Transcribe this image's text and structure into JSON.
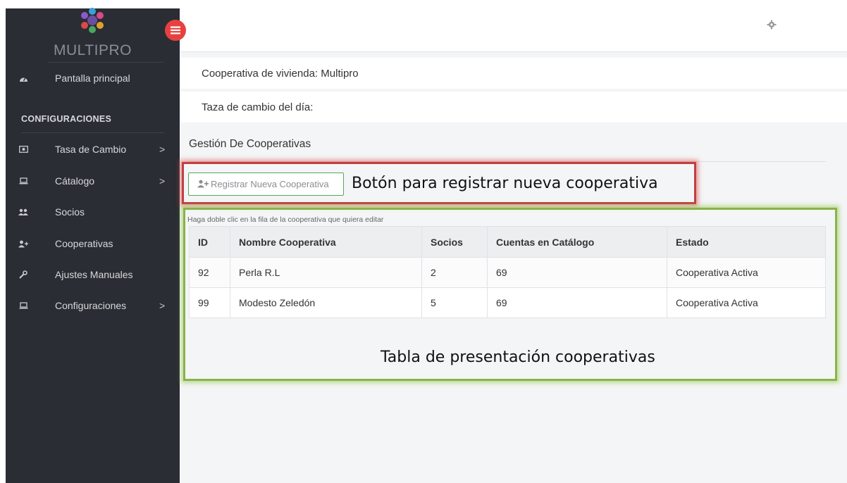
{
  "brand": {
    "name": "MULTIPRO"
  },
  "sidebar": {
    "items": [
      {
        "label": "Pantalla principal",
        "icon": "dashboard-icon"
      },
      {
        "label": "Tasa de Cambio",
        "icon": "money-icon",
        "has_submenu": true
      },
      {
        "label": "Cátalogo",
        "icon": "laptop-icon",
        "has_submenu": true
      },
      {
        "label": "Socios",
        "icon": "users-icon"
      },
      {
        "label": "Cooperativas",
        "icon": "user-plus-icon"
      },
      {
        "label": "Ajustes Manuales",
        "icon": "wrench-icon"
      },
      {
        "label": "Configuraciones",
        "icon": "laptop-icon",
        "has_submenu": true
      }
    ],
    "section_header": "CONFIGURACIONES",
    "chevron": ">"
  },
  "info": {
    "cooperative": "Cooperativa de vivienda: Multipro",
    "exchange_rate": "Taza de cambio del día:"
  },
  "page": {
    "title": "Gestión De Cooperativas",
    "register_button": "Registrar Nueva Cooperativa",
    "hint": "Haga doble clic en la fila de la cooperativa que quiera editar"
  },
  "table": {
    "headers": [
      "ID",
      "Nombre Cooperativa",
      "Socios",
      "Cuentas en Catálogo",
      "Estado"
    ],
    "rows": [
      [
        "92",
        "Perla R.L",
        "2",
        "69",
        "Cooperativa Activa"
      ],
      [
        "99",
        "Modesto Zeledón",
        "5",
        "69",
        "Cooperativa Activa"
      ]
    ]
  },
  "annotations": {
    "button_note": "Botón para registrar nueva cooperativa",
    "table_note": "Tabla de presentación cooperativas"
  },
  "colors": {
    "sidebar_bg": "#2a2d33",
    "toggle_accent": "#e7413f",
    "button_border": "#55a85a",
    "annotation_red": "#c04040",
    "annotation_green": "#8ab24c"
  }
}
